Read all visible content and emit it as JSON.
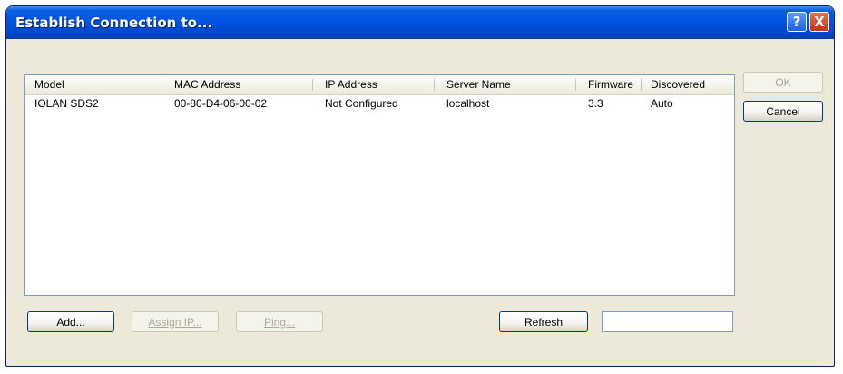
{
  "window": {
    "title": "Establish Connection to...",
    "help_glyph": "?",
    "close_glyph": "X"
  },
  "list": {
    "columns": [
      "Model",
      "MAC Address",
      "IP Address",
      "Server Name",
      "Firmware",
      "Discovered"
    ],
    "rows": [
      {
        "model": "IOLAN SDS2",
        "mac": "00-80-D4-06-00-02",
        "ip": "Not Configured",
        "server": "localhost",
        "firmware": "3.3",
        "discovered": "Auto"
      }
    ]
  },
  "buttons": {
    "ok": "OK",
    "cancel": "Cancel",
    "add": "Add...",
    "assign_ip": "Assign IP...",
    "ping": "Ping...",
    "refresh": "Refresh"
  },
  "status_text": ""
}
